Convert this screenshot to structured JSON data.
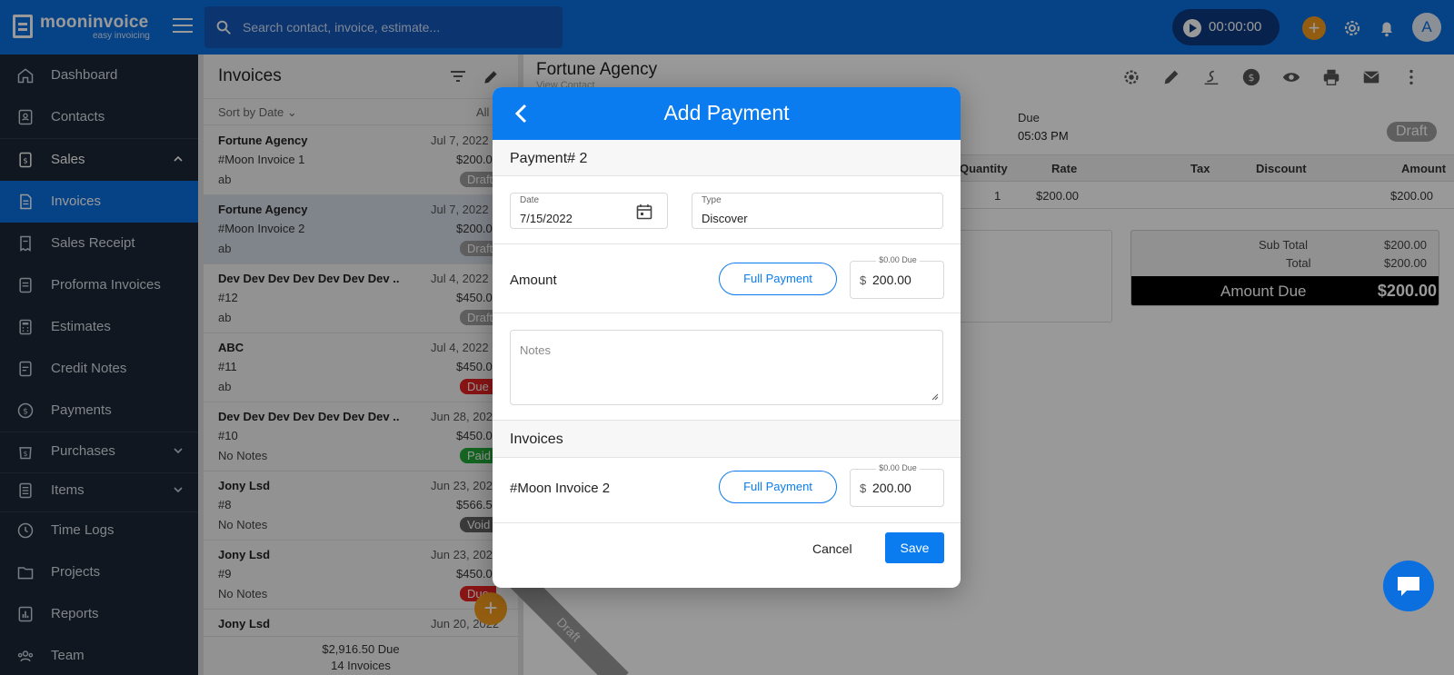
{
  "app": {
    "logo_name": "mooninvoice",
    "logo_tagline": "easy invoicing",
    "accent_color": "#0b6fe0",
    "orange_color": "#f39c1b"
  },
  "topbar": {
    "search_placeholder": "Search contact, invoice, estimate...",
    "timer": "00:00:00",
    "avatar_letter": "A"
  },
  "sidebar": {
    "items": [
      {
        "label": "Dashboard",
        "icon": "home-icon"
      },
      {
        "label": "Contacts",
        "icon": "contact-card-icon"
      },
      {
        "label": "Sales",
        "icon": "sales-icon"
      },
      {
        "label": "Invoices",
        "icon": "invoice-icon"
      },
      {
        "label": "Sales Receipt",
        "icon": "receipt-icon"
      },
      {
        "label": "Proforma Invoices",
        "icon": "document-icon"
      },
      {
        "label": "Estimates",
        "icon": "calculator-icon"
      },
      {
        "label": "Credit Notes",
        "icon": "credit-note-icon"
      },
      {
        "label": "Payments",
        "icon": "dollar-circle-icon"
      },
      {
        "label": "Purchases",
        "icon": "purchase-icon"
      },
      {
        "label": "Items",
        "icon": "list-icon"
      },
      {
        "label": "Time Logs",
        "icon": "clock-icon"
      },
      {
        "label": "Projects",
        "icon": "folder-icon"
      },
      {
        "label": "Reports",
        "icon": "bar-chart-icon"
      },
      {
        "label": "Team",
        "icon": "team-icon"
      }
    ]
  },
  "list": {
    "title": "Invoices",
    "sort_label": "Sort by Date",
    "filter_all": "All",
    "rows": [
      {
        "name": "Fortune Agency",
        "date": "Jul 7, 2022",
        "number": "#Moon Invoice 1",
        "amount": "$200.00",
        "note": "ab",
        "status": "Draft",
        "status_color": "#9e9e9e"
      },
      {
        "name": "Fortune Agency",
        "date": "Jul 7, 2022",
        "number": "#Moon Invoice 2",
        "amount": "$200.00",
        "note": "ab",
        "status": "Draft",
        "status_color": "#9e9e9e"
      },
      {
        "name": "Dev Dev Dev Dev Dev Dev Dev ...",
        "date": "Jul 4, 2022",
        "number": "#12",
        "amount": "$450.00",
        "note": "ab",
        "status": "Draft",
        "status_color": "#9e9e9e"
      },
      {
        "name": "ABC",
        "date": "Jul 4, 2022",
        "number": "#11",
        "amount": "$450.00",
        "note": "ab",
        "status": "Due",
        "status_color": "#e52222"
      },
      {
        "name": "Dev Dev Dev Dev Dev Dev Dev ...",
        "date": "Jun 28, 2022",
        "number": "#10",
        "amount": "$450.00",
        "note": "No Notes",
        "status": "Paid",
        "status_color": "#22a838"
      },
      {
        "name": "Jony Lsd",
        "date": "Jun 23, 2022",
        "number": "#8",
        "amount": "$566.50",
        "note": "No Notes",
        "status": "Void",
        "status_color": "#616161"
      },
      {
        "name": "Jony Lsd",
        "date": "Jun 23, 2022",
        "number": "#9",
        "amount": "$450.00",
        "note": "No Notes",
        "status": "Due",
        "status_color": "#e52222"
      },
      {
        "name": "Jony Lsd",
        "date": "Jun 20, 2022",
        "number": "",
        "amount": "",
        "note": "",
        "status": "",
        "status_color": "#9e9e9e"
      }
    ],
    "footer_due": "$2,916.50  Due",
    "footer_count": "14 Invoices"
  },
  "detail": {
    "title": "Fortune Agency",
    "subtitle": "View Contact",
    "due_label": "Due",
    "due_time": "05:03 PM",
    "status": "Draft",
    "columns": [
      "Quantity",
      "Rate",
      "Tax",
      "Discount",
      "Amount"
    ],
    "row": {
      "quantity": "1",
      "rate": "$200.00",
      "amount": "$200.00"
    },
    "subtotal_label": "Sub Total",
    "subtotal": "$200.00",
    "total_label": "Total",
    "total": "$200.00",
    "amount_due_label": "Amount Due",
    "amount_due": "$200.00",
    "ribbon": "Draft"
  },
  "modal": {
    "title": "Add Payment",
    "payment_number": "Payment# 2",
    "date_label": "Date",
    "date_value": "7/15/2022",
    "type_label": "Type",
    "type_value": "Discover",
    "amount_label": "Amount",
    "full_payment": "Full Payment",
    "due_hint": "$0.00 Due",
    "currency": "$",
    "amount_value": "200.00",
    "notes_placeholder": "Notes",
    "invoices_label": "Invoices",
    "invoice_name": "#Moon Invoice 2",
    "invoice_amount": "200.00",
    "cancel": "Cancel",
    "save": "Save"
  }
}
